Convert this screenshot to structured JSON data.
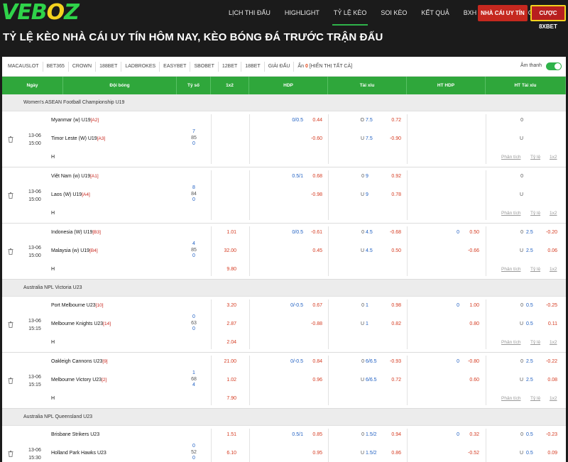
{
  "nav": {
    "logo_a": "VEB",
    "logo_b": "O",
    "logo_c": "Z",
    "items": [
      "LỊCH THI ĐẤU",
      "HIGHLIGHT",
      "TỶ LỆ KÈO",
      "SOI KÈO",
      "KẾT QUẢ",
      "BXH",
      "TUYỂN DỤNG"
    ],
    "active_index": 2,
    "btn_red": "NHÀ CÁI UY TÍN",
    "btn_yellow": "CƯỢC 8XBET"
  },
  "page_title": "TỶ LỆ KÈO NHÀ CÁI UY TÍN HÔM NAY, KÈO BÓNG ĐÁ TRƯỚC TRẬN ĐẤU",
  "bookies": [
    "MACAUSLOT",
    "BET365",
    "CROWN",
    "188BET",
    "LADBROKES",
    "EASYBET",
    "SBOBET",
    "12BET",
    "18BET",
    "GIẢI ĐẤU"
  ],
  "hidden": {
    "label": "Ẩn",
    "count": "0",
    "show_all": "[HIỂN THỊ TẤT CẢ]"
  },
  "sound_label": "Âm thanh",
  "headers": [
    "Ngày",
    "Đội bóng",
    "Tỷ số",
    "1x2",
    "HDP",
    "Tài xỉu",
    "HT HDP",
    "HT Tài xỉu"
  ],
  "link_labels": {
    "analysis": "Phân tích",
    "odds": "Tỷ lệ",
    "x12": "1x2"
  },
  "leagues": [
    {
      "name": "Women's ASEAN Football Championship U19",
      "matches": [
        {
          "date": "13-06",
          "time": "15:00",
          "home": "Myanmar (w) U19",
          "home_rank": "[A2]",
          "away": "Timor Leste (W) U19",
          "away_rank": "[A3]",
          "draw": "H",
          "score": [
            "7",
            "85",
            "0"
          ],
          "x12": [
            "",
            "",
            ""
          ],
          "hdp_line": "0/0.5",
          "hdp_home": "0.44",
          "hdp_away": "-0.60",
          "ou_o": "O",
          "ou_line_o": "7.5",
          "ou_o_val": "0.72",
          "ou_u": "U",
          "ou_line_u": "7.5",
          "ou_u_val": "-0.90",
          "hthdp_line": "",
          "hthdp_home": "",
          "hthdp_away": "",
          "htou_o": "0",
          "htou_line_o": "",
          "htou_o_val": "",
          "htou_u": "U",
          "htou_line_u": "",
          "htou_u_val": ""
        },
        {
          "date": "13-06",
          "time": "15:00",
          "home": "Việt Nam (w) U19",
          "home_rank": "[A1]",
          "away": "Laos (W) U19",
          "away_rank": "[A4]",
          "draw": "H",
          "score": [
            "8",
            "84",
            "0"
          ],
          "x12": [
            "",
            "",
            ""
          ],
          "hdp_line": "0.5/1",
          "hdp_home": "0.68",
          "hdp_away": "-0.98",
          "ou_o": "0",
          "ou_line_o": "9",
          "ou_o_val": "0.92",
          "ou_u": "U",
          "ou_line_u": "9",
          "ou_u_val": "0.78",
          "hthdp_line": "",
          "hthdp_home": "",
          "hthdp_away": "",
          "htou_o": "0",
          "htou_line_o": "",
          "htou_o_val": "",
          "htou_u": "U",
          "htou_line_u": "",
          "htou_u_val": ""
        },
        {
          "date": "13-06",
          "time": "15:00",
          "home": "Indonesia (W) U19",
          "home_rank": "[B3]",
          "away": "Malaysia (w) U19",
          "away_rank": "[B4]",
          "draw": "H",
          "score": [
            "4",
            "85",
            "0"
          ],
          "x12": [
            "1.01",
            "32.00",
            "9.80"
          ],
          "hdp_line": "0/0.5",
          "hdp_home": "-0.61",
          "hdp_away": "0.45",
          "ou_o": "0",
          "ou_line_o": "4.5",
          "ou_o_val": "-0.68",
          "ou_u": "U",
          "ou_line_u": "4.5",
          "ou_u_val": "0.50",
          "hthdp_line": "0",
          "hthdp_home": "0.50",
          "hthdp_away": "-0.66",
          "htou_o": "0",
          "htou_line_o": "2.5",
          "htou_o_val": "-0.20",
          "htou_u": "U",
          "htou_line_u": "2.5",
          "htou_u_val": "0.06"
        }
      ]
    },
    {
      "name": "Australia NPL Victoria U23",
      "matches": [
        {
          "date": "13-06",
          "time": "15:15",
          "home": "Port Melbourne U23",
          "home_rank": "[10]",
          "away": "Melbourne Knights U23",
          "away_rank": "[14]",
          "draw": "H",
          "score": [
            "0",
            "63",
            "0"
          ],
          "x12": [
            "3.20",
            "2.87",
            "2.04"
          ],
          "hdp_line": "0/-0.5",
          "hdp_home": "0.67",
          "hdp_away": "-0.88",
          "ou_o": "0",
          "ou_line_o": "1",
          "ou_o_val": "0.98",
          "ou_u": "U",
          "ou_line_u": "1",
          "ou_u_val": "0.82",
          "hthdp_line": "0",
          "hthdp_home": "1.00",
          "hthdp_away": "0.80",
          "htou_o": "0",
          "htou_line_o": "0.5",
          "htou_o_val": "-0.25",
          "htou_u": "U",
          "htou_line_u": "0.5",
          "htou_u_val": "0.11"
        },
        {
          "date": "13-06",
          "time": "15:15",
          "home": "Oakleigh Cannons U23",
          "home_rank": "[9]",
          "away": "Melbourne Victory U23",
          "away_rank": "[2]",
          "draw": "H",
          "score": [
            "1",
            "68",
            "4"
          ],
          "x12": [
            "21.00",
            "1.02",
            "7.90"
          ],
          "hdp_line": "0/-0.5",
          "hdp_home": "0.84",
          "hdp_away": "0.96",
          "ou_o": "0",
          "ou_line_o": "6/6.5",
          "ou_o_val": "-0.93",
          "ou_u": "U",
          "ou_line_u": "6/6.5",
          "ou_u_val": "0.72",
          "hthdp_line": "0",
          "hthdp_home": "-0.80",
          "hthdp_away": "0.60",
          "htou_o": "0",
          "htou_line_o": "2.5",
          "htou_o_val": "-0.22",
          "htou_u": "U",
          "htou_line_u": "2.5",
          "htou_u_val": "0.08"
        }
      ]
    },
    {
      "name": "Australia NPL Queensland U23",
      "matches": [
        {
          "date": "13-06",
          "time": "15:30",
          "home": "Brisbane Strikers U23",
          "home_rank": "",
          "away": "Holland Park Hawks U23",
          "away_rank": "",
          "draw": "H",
          "score": [
            "0",
            "52",
            "0"
          ],
          "x12": [
            "1.51",
            "6.10",
            ""
          ],
          "hdp_line": "0.5/1",
          "hdp_home": "0.85",
          "hdp_away": "0.95",
          "ou_o": "0",
          "ou_line_o": "1.5/2",
          "ou_o_val": "0.94",
          "ou_u": "U",
          "ou_line_u": "1.5/2",
          "ou_u_val": "0.86",
          "hthdp_line": "0",
          "hthdp_home": "0.32",
          "hthdp_away": "-0.52",
          "htou_o": "0",
          "htou_line_o": "0.5",
          "htou_o_val": "-0.23",
          "htou_u": "U",
          "htou_line_u": "0.5",
          "htou_u_val": "0.09"
        }
      ]
    }
  ]
}
